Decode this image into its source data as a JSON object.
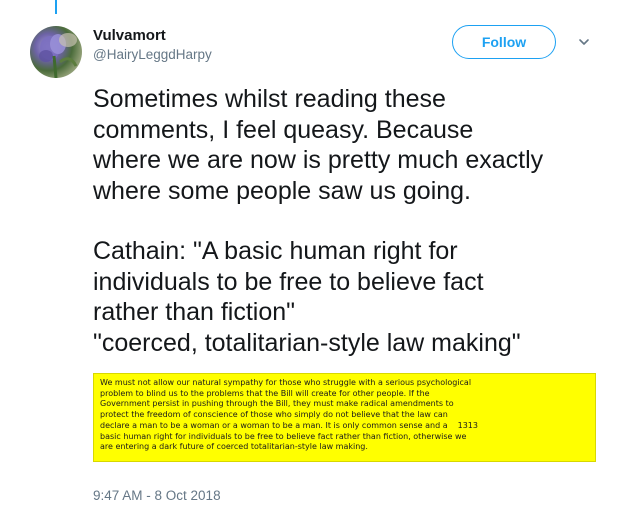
{
  "tweet": {
    "display_name": "Vulvamort",
    "handle": "@HairyLeggdHarpy",
    "follow_label": "Follow",
    "body_para1": [
      "Sometimes whilst reading these",
      "comments, I feel queasy.  Because",
      "where we are now is pretty much exactly",
      "where some people saw us going."
    ],
    "body_para2": [
      "Cathain: \"A basic human right for",
      "individuals to be free to believe fact",
      "rather than fiction\"",
      "\"coerced, totalitarian-style law making\""
    ],
    "quote_image": {
      "lines": [
        "We must not allow our natural sympathy for those who struggle with a serious psychological",
        "problem to blind us to the problems that the Bill will create for other people. If the",
        "Government persist in pushing through the Bill, they must make radical amendments to",
        "protect the freedom of conscience of those who simply do not believe that the law can",
        "declare a man to be a woman or a woman to be a man. It is only common sense and a",
        "basic human right for individuals to be free to believe fact rather than fiction, otherwise we",
        "are entering a dark future of coerced totalitarian-style law making."
      ],
      "column_number": "1313",
      "background": "#ffff00"
    },
    "timestamp": "9:47 AM - 8 Oct 2018"
  },
  "icons": {
    "avatar": "avatar-iris-photo",
    "caret": "chevron-down-icon"
  },
  "colors": {
    "accent": "#1da1f2",
    "text": "#14171a",
    "muted": "#657786"
  }
}
